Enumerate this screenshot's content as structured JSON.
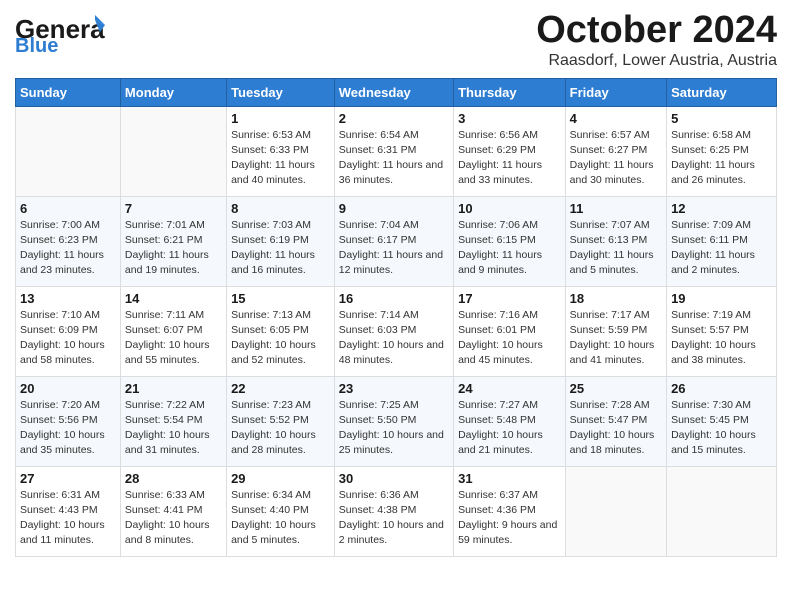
{
  "header": {
    "logo_general": "General",
    "logo_blue": "Blue",
    "month_title": "October 2024",
    "location": "Raasdorf, Lower Austria, Austria"
  },
  "weekdays": [
    "Sunday",
    "Monday",
    "Tuesday",
    "Wednesday",
    "Thursday",
    "Friday",
    "Saturday"
  ],
  "weeks": [
    [
      {
        "day": "",
        "sunrise": "",
        "sunset": "",
        "daylight": ""
      },
      {
        "day": "",
        "sunrise": "",
        "sunset": "",
        "daylight": ""
      },
      {
        "day": "1",
        "sunrise": "Sunrise: 6:53 AM",
        "sunset": "Sunset: 6:33 PM",
        "daylight": "Daylight: 11 hours and 40 minutes."
      },
      {
        "day": "2",
        "sunrise": "Sunrise: 6:54 AM",
        "sunset": "Sunset: 6:31 PM",
        "daylight": "Daylight: 11 hours and 36 minutes."
      },
      {
        "day": "3",
        "sunrise": "Sunrise: 6:56 AM",
        "sunset": "Sunset: 6:29 PM",
        "daylight": "Daylight: 11 hours and 33 minutes."
      },
      {
        "day": "4",
        "sunrise": "Sunrise: 6:57 AM",
        "sunset": "Sunset: 6:27 PM",
        "daylight": "Daylight: 11 hours and 30 minutes."
      },
      {
        "day": "5",
        "sunrise": "Sunrise: 6:58 AM",
        "sunset": "Sunset: 6:25 PM",
        "daylight": "Daylight: 11 hours and 26 minutes."
      }
    ],
    [
      {
        "day": "6",
        "sunrise": "Sunrise: 7:00 AM",
        "sunset": "Sunset: 6:23 PM",
        "daylight": "Daylight: 11 hours and 23 minutes."
      },
      {
        "day": "7",
        "sunrise": "Sunrise: 7:01 AM",
        "sunset": "Sunset: 6:21 PM",
        "daylight": "Daylight: 11 hours and 19 minutes."
      },
      {
        "day": "8",
        "sunrise": "Sunrise: 7:03 AM",
        "sunset": "Sunset: 6:19 PM",
        "daylight": "Daylight: 11 hours and 16 minutes."
      },
      {
        "day": "9",
        "sunrise": "Sunrise: 7:04 AM",
        "sunset": "Sunset: 6:17 PM",
        "daylight": "Daylight: 11 hours and 12 minutes."
      },
      {
        "day": "10",
        "sunrise": "Sunrise: 7:06 AM",
        "sunset": "Sunset: 6:15 PM",
        "daylight": "Daylight: 11 hours and 9 minutes."
      },
      {
        "day": "11",
        "sunrise": "Sunrise: 7:07 AM",
        "sunset": "Sunset: 6:13 PM",
        "daylight": "Daylight: 11 hours and 5 minutes."
      },
      {
        "day": "12",
        "sunrise": "Sunrise: 7:09 AM",
        "sunset": "Sunset: 6:11 PM",
        "daylight": "Daylight: 11 hours and 2 minutes."
      }
    ],
    [
      {
        "day": "13",
        "sunrise": "Sunrise: 7:10 AM",
        "sunset": "Sunset: 6:09 PM",
        "daylight": "Daylight: 10 hours and 58 minutes."
      },
      {
        "day": "14",
        "sunrise": "Sunrise: 7:11 AM",
        "sunset": "Sunset: 6:07 PM",
        "daylight": "Daylight: 10 hours and 55 minutes."
      },
      {
        "day": "15",
        "sunrise": "Sunrise: 7:13 AM",
        "sunset": "Sunset: 6:05 PM",
        "daylight": "Daylight: 10 hours and 52 minutes."
      },
      {
        "day": "16",
        "sunrise": "Sunrise: 7:14 AM",
        "sunset": "Sunset: 6:03 PM",
        "daylight": "Daylight: 10 hours and 48 minutes."
      },
      {
        "day": "17",
        "sunrise": "Sunrise: 7:16 AM",
        "sunset": "Sunset: 6:01 PM",
        "daylight": "Daylight: 10 hours and 45 minutes."
      },
      {
        "day": "18",
        "sunrise": "Sunrise: 7:17 AM",
        "sunset": "Sunset: 5:59 PM",
        "daylight": "Daylight: 10 hours and 41 minutes."
      },
      {
        "day": "19",
        "sunrise": "Sunrise: 7:19 AM",
        "sunset": "Sunset: 5:57 PM",
        "daylight": "Daylight: 10 hours and 38 minutes."
      }
    ],
    [
      {
        "day": "20",
        "sunrise": "Sunrise: 7:20 AM",
        "sunset": "Sunset: 5:56 PM",
        "daylight": "Daylight: 10 hours and 35 minutes."
      },
      {
        "day": "21",
        "sunrise": "Sunrise: 7:22 AM",
        "sunset": "Sunset: 5:54 PM",
        "daylight": "Daylight: 10 hours and 31 minutes."
      },
      {
        "day": "22",
        "sunrise": "Sunrise: 7:23 AM",
        "sunset": "Sunset: 5:52 PM",
        "daylight": "Daylight: 10 hours and 28 minutes."
      },
      {
        "day": "23",
        "sunrise": "Sunrise: 7:25 AM",
        "sunset": "Sunset: 5:50 PM",
        "daylight": "Daylight: 10 hours and 25 minutes."
      },
      {
        "day": "24",
        "sunrise": "Sunrise: 7:27 AM",
        "sunset": "Sunset: 5:48 PM",
        "daylight": "Daylight: 10 hours and 21 minutes."
      },
      {
        "day": "25",
        "sunrise": "Sunrise: 7:28 AM",
        "sunset": "Sunset: 5:47 PM",
        "daylight": "Daylight: 10 hours and 18 minutes."
      },
      {
        "day": "26",
        "sunrise": "Sunrise: 7:30 AM",
        "sunset": "Sunset: 5:45 PM",
        "daylight": "Daylight: 10 hours and 15 minutes."
      }
    ],
    [
      {
        "day": "27",
        "sunrise": "Sunrise: 6:31 AM",
        "sunset": "Sunset: 4:43 PM",
        "daylight": "Daylight: 10 hours and 11 minutes."
      },
      {
        "day": "28",
        "sunrise": "Sunrise: 6:33 AM",
        "sunset": "Sunset: 4:41 PM",
        "daylight": "Daylight: 10 hours and 8 minutes."
      },
      {
        "day": "29",
        "sunrise": "Sunrise: 6:34 AM",
        "sunset": "Sunset: 4:40 PM",
        "daylight": "Daylight: 10 hours and 5 minutes."
      },
      {
        "day": "30",
        "sunrise": "Sunrise: 6:36 AM",
        "sunset": "Sunset: 4:38 PM",
        "daylight": "Daylight: 10 hours and 2 minutes."
      },
      {
        "day": "31",
        "sunrise": "Sunrise: 6:37 AM",
        "sunset": "Sunset: 4:36 PM",
        "daylight": "Daylight: 9 hours and 59 minutes."
      },
      {
        "day": "",
        "sunrise": "",
        "sunset": "",
        "daylight": ""
      },
      {
        "day": "",
        "sunrise": "",
        "sunset": "",
        "daylight": ""
      }
    ]
  ]
}
